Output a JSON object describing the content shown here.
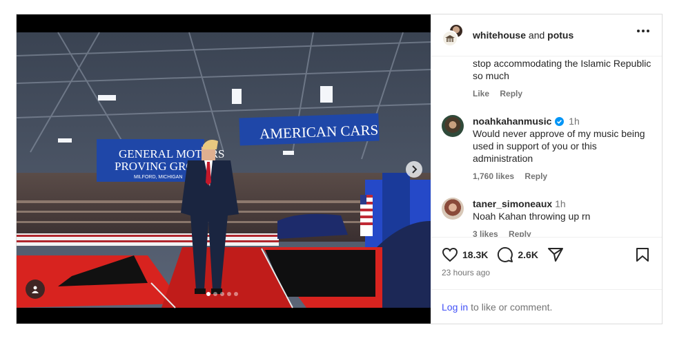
{
  "header": {
    "user1": "whitehouse",
    "joiner": "and",
    "user2": "potus"
  },
  "media": {
    "banner_left_line1": "GENERAL MOTORS",
    "banner_left_line2": "PROVING GROUND",
    "banner_left_line3": "MILFORD, MICHIGAN",
    "banner_right": "AMERICAN CARS",
    "slide_count": 5,
    "active_slide": 1
  },
  "comments": [
    {
      "user": "",
      "text": "stop accommodating the Islamic Republic so much",
      "likes": "",
      "like_label": "Like",
      "reply_label": "Reply"
    },
    {
      "user": "noahkahanmusic",
      "verified": true,
      "time": "1h",
      "text": "Would never approve of my music being used in support of you or this administration",
      "likes": "1,760 likes",
      "reply_label": "Reply"
    },
    {
      "user": "taner_simoneaux",
      "time": "1h",
      "text": "Noah Kahan throwing up rn",
      "likes": "3 likes",
      "reply_label": "Reply"
    }
  ],
  "actions": {
    "like_count": "18.3K",
    "comment_count": "2.6K",
    "posted": "23 hours ago"
  },
  "login": {
    "link": "Log in",
    "rest": "to like or comment."
  },
  "colors": {
    "link": "#4150f7",
    "verified": "#0095f6",
    "muted": "#737373"
  }
}
